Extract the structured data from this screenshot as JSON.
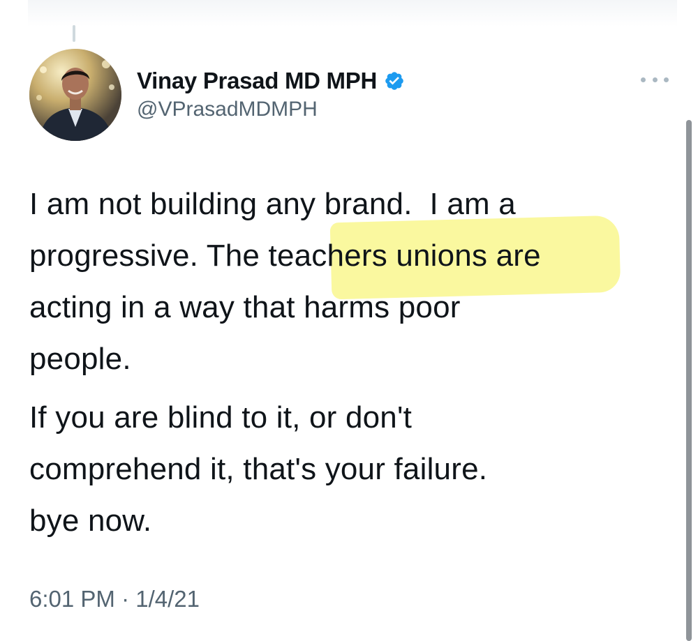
{
  "author": {
    "display_name": "Vinay Prasad MD MPH",
    "handle": "@VPrasadMDMPH",
    "verified": true
  },
  "tweet": {
    "paragraphs": [
      "I am not building any brand.  I am a\nprogressive. The teachers unions are\nacting in a way that harms poor\npeople.",
      "If you are blind to it, or don't\ncomprehend it, that's your failure.\nbye now."
    ],
    "time": "6:01 PM",
    "separator": " · ",
    "date": "1/4/21"
  },
  "icons": {
    "verified": "verified-badge-icon",
    "more": "more-options-icon"
  },
  "colors": {
    "verified_blue": "#1d9bf0",
    "secondary_text": "#536471",
    "highlight": "#f5f350"
  }
}
